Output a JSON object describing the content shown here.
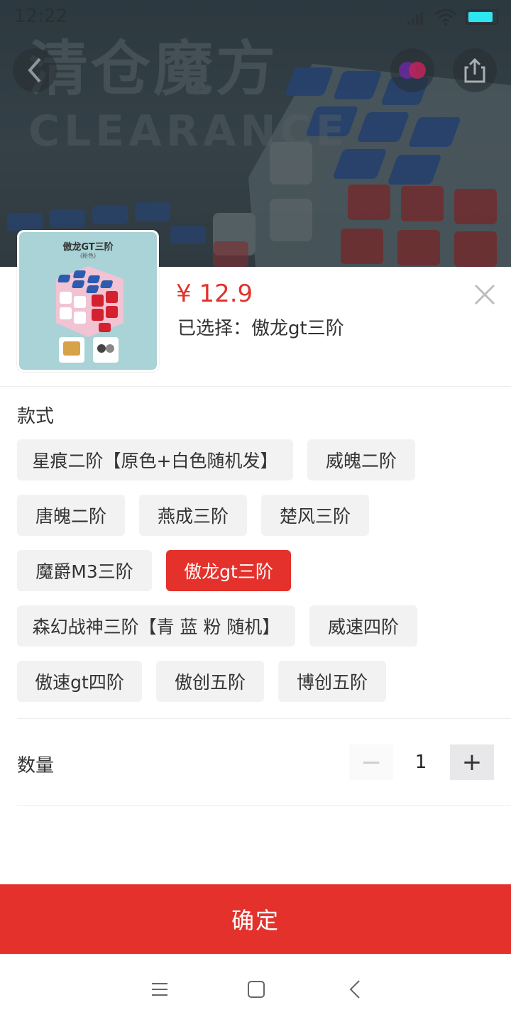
{
  "status_bar": {
    "time": "12:22",
    "battery_level": 0.9
  },
  "background": {
    "headline": "清仓魔方",
    "subline": "CLEARANCE",
    "back_icon": "chevron-left-icon",
    "share_icon": "share-icon"
  },
  "product": {
    "thumb_title": "傲龙GT三阶",
    "thumb_subtitle": "(粉色)",
    "price": "¥ 12.9",
    "selected_text": "已选择：傲龙gt三阶",
    "close_icon": "close-icon"
  },
  "styles_section": {
    "label": "款式",
    "options": [
      {
        "label": "星痕二阶【原色+白色随机发】",
        "selected": false
      },
      {
        "label": "威魄二阶",
        "selected": false
      },
      {
        "label": "唐魄二阶",
        "selected": false
      },
      {
        "label": "燕成三阶",
        "selected": false
      },
      {
        "label": "楚风三阶",
        "selected": false
      },
      {
        "label": "魔爵M3三阶",
        "selected": false
      },
      {
        "label": "傲龙gt三阶",
        "selected": true
      },
      {
        "label": "森幻战神三阶【青 蓝 粉 随机】",
        "selected": false
      },
      {
        "label": "威速四阶",
        "selected": false
      },
      {
        "label": "傲速gt四阶",
        "selected": false
      },
      {
        "label": "傲创五阶",
        "selected": false
      },
      {
        "label": "博创五阶",
        "selected": false
      }
    ]
  },
  "quantity": {
    "label": "数量",
    "minus": "−",
    "value": "1",
    "plus": "+"
  },
  "confirm_label": "确定",
  "nav": {
    "menu_icon": "menu-icon",
    "home_icon": "home-square-icon",
    "back_icon": "back-triangle-icon"
  },
  "colors": {
    "accent": "#e4312b",
    "chip_bg": "#f2f2f2"
  }
}
